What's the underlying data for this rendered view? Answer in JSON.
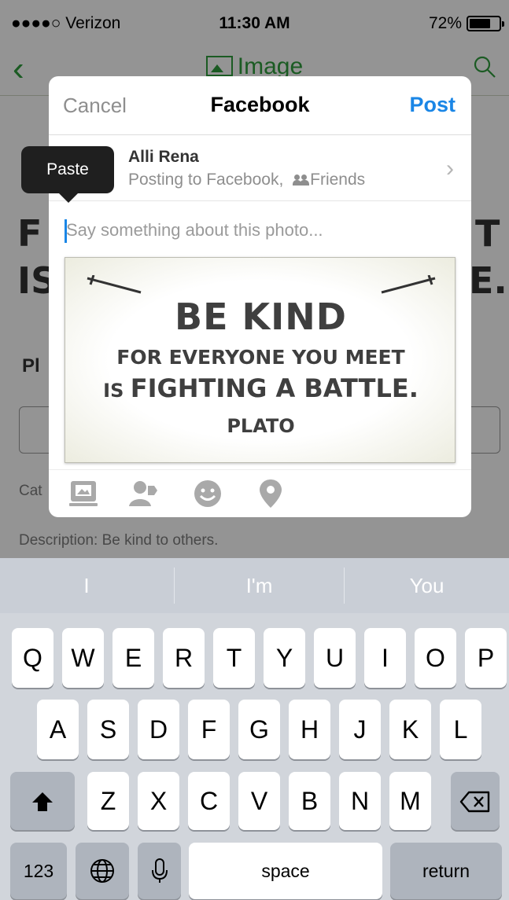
{
  "status_bar": {
    "carrier": "●●●●○ Verizon",
    "time": "11:30 AM",
    "battery": "72%",
    "battery_level": 0.72
  },
  "nav": {
    "title": "Image"
  },
  "background": {
    "line1_left": "F",
    "line1_right": "T",
    "line2_left": "IS",
    "line2_right": "E.",
    "label": "Pl",
    "category": "Cat",
    "description": "Description: Be kind to others."
  },
  "sheet": {
    "cancel": "Cancel",
    "title": "Facebook",
    "post": "Post",
    "account": {
      "name": "Alli Rena",
      "subtitle_prefix": "Posting to Facebook,",
      "audience": "Friends"
    },
    "caption_placeholder": "Say something about this photo...",
    "photo_text": {
      "line1": "BE KIND",
      "line2": "FOR EVERYONE YOU MEET",
      "line3_prefix": "IS ",
      "line3_main": "FIGHTING A BATTLE",
      "line3_suffix": ".",
      "line4": "PLATO"
    },
    "toolbar_icons": [
      "album-icon",
      "tag-people-icon",
      "emoji-icon",
      "location-pin-icon"
    ]
  },
  "paste_menu": {
    "label": "Paste"
  },
  "keyboard": {
    "predictions": [
      "I",
      "I'm",
      "You"
    ],
    "row1": [
      "Q",
      "W",
      "E",
      "R",
      "T",
      "Y",
      "U",
      "I",
      "O",
      "P"
    ],
    "row2": [
      "A",
      "S",
      "D",
      "F",
      "G",
      "H",
      "J",
      "K",
      "L"
    ],
    "row3": [
      "Z",
      "X",
      "C",
      "V",
      "B",
      "N",
      "M"
    ],
    "numbers_key": "123",
    "space_key": "space",
    "return_key": "return"
  },
  "colors": {
    "accent_green": "#2f9d3d",
    "facebook_blue": "#1a86e6"
  }
}
